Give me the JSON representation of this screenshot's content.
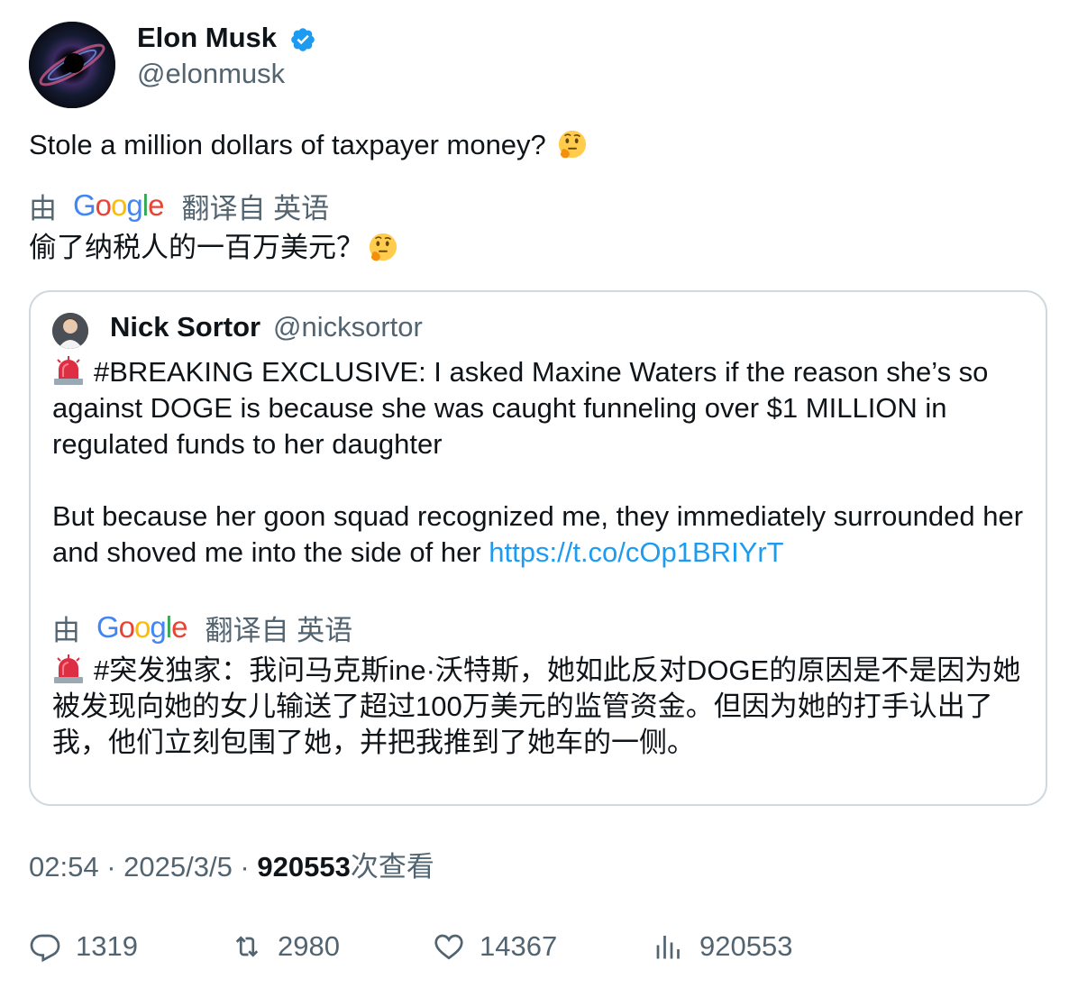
{
  "author": {
    "name": "Elon Musk",
    "handle": "@elonmusk",
    "verified": true,
    "badge_color": "#1d9bf0"
  },
  "tweet": {
    "text": "Stole a million dollars of taxpayer money?",
    "translation_by": "由",
    "translation_source": "翻译自 英语",
    "translated_text": "偷了纳税人的一百万美元？"
  },
  "quote": {
    "name": "Nick Sortor",
    "handle": "@nicksortor",
    "text_1": "#BREAKING EXCLUSIVE: I asked Maxine Waters if the reason she’s so against DOGE is because she was caught funneling over $1 MILLION in regulated funds to her daughter",
    "text_2": "But because her goon squad recognized me, they immediately surrounded her and shoved me into the side of her",
    "link": "https://t.co/cOp1BRIYrT",
    "translation_by": "由",
    "translation_source": "翻译自 英语",
    "translated_text": "#突发独家：我问马克斯ine·沃特斯，她如此反对DOGE的原因是不是因为她被发现向她的女儿输送了超过100万美元的监管资金。但因为她的打手认出了我，他们立刻包围了她，并把我推到了她车的一侧。"
  },
  "meta": {
    "time": "02:54",
    "date": "2025/3/5",
    "views": "920553",
    "views_label": "次查看",
    "sep": " · "
  },
  "actions": {
    "replies": "1319",
    "retweets": "2980",
    "likes": "14367",
    "views": "920553"
  },
  "google_logo": "Google",
  "colors": {
    "text": "#0f1419",
    "secondary": "#536471",
    "link": "#1d9bf0",
    "border": "#cfd9de"
  }
}
